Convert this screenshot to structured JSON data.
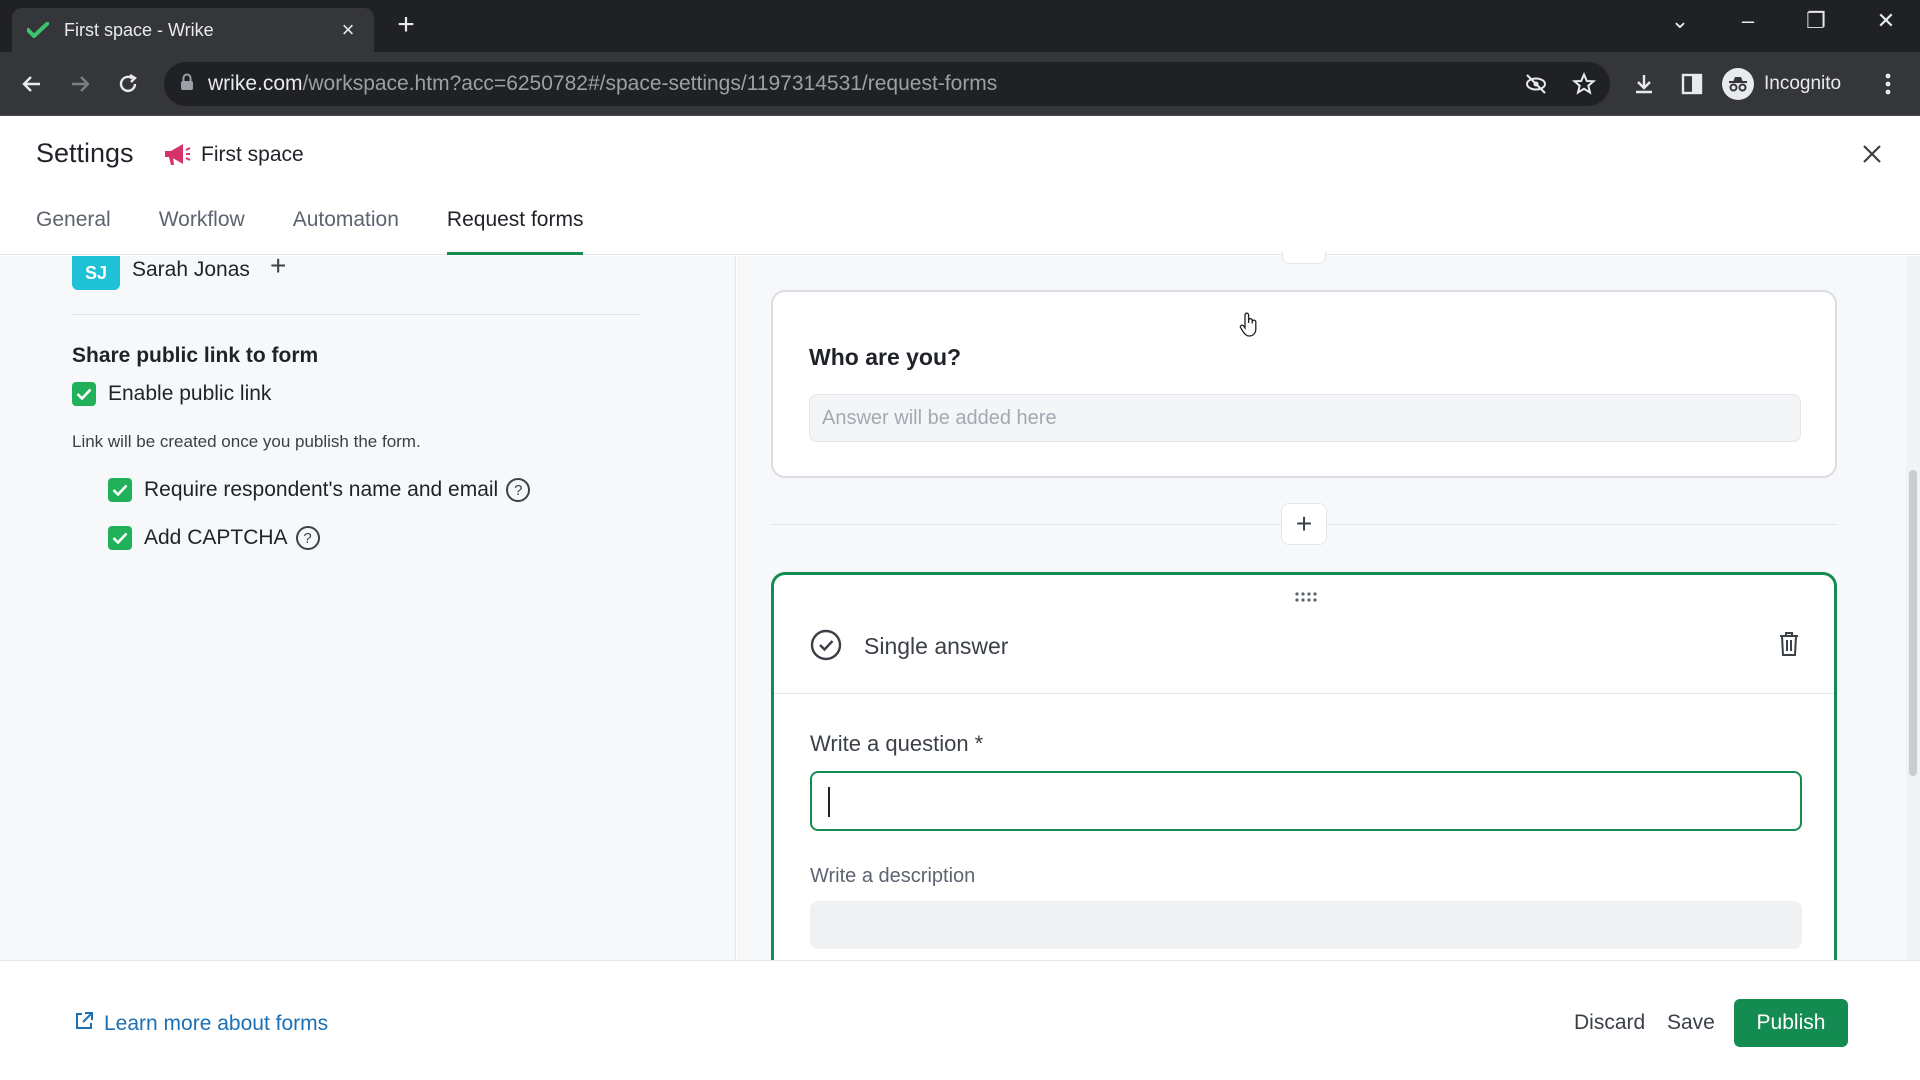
{
  "browser": {
    "tab_title": "First space - Wrike",
    "url_host": "wrike.com",
    "url_path": "/workspace.htm?acc=6250782#/space-settings/1197314531/request-forms",
    "profile_label": "Incognito"
  },
  "header": {
    "title": "Settings",
    "space_name": "First space",
    "tabs": [
      "General",
      "Workflow",
      "Automation",
      "Request forms"
    ],
    "active_tab": "Request forms"
  },
  "left_panel": {
    "user_initials": "SJ",
    "user_name": "Sarah Jonas",
    "share_heading": "Share public link to form",
    "enable_public_link": "Enable public link",
    "enable_public_link_checked": true,
    "link_hint": "Link will be created once you publish the form.",
    "require_name_email": "Require respondent's name and email",
    "require_name_email_checked": true,
    "add_captcha": "Add CAPTCHA",
    "add_captcha_checked": true,
    "help_glyph": "?"
  },
  "form": {
    "question_card": {
      "question": "Who are you?",
      "answer_placeholder": "Answer will be added here"
    },
    "add_button_glyph": "+",
    "edit_card": {
      "type_label": "Single answer",
      "question_label": "Write a question *",
      "question_value": "",
      "description_label": "Write a description",
      "description_value": ""
    }
  },
  "footer": {
    "learn_more": "Learn more about forms",
    "discard": "Discard",
    "save": "Save",
    "publish": "Publish"
  },
  "colors": {
    "accent_green": "#148c51",
    "checkbox_green": "#20b15a",
    "avatar_cyan": "#1ec1d6",
    "link_blue": "#1a6fb5",
    "space_icon_pink": "#d6336c"
  },
  "icons": [
    "wrike-check-icon",
    "close-icon",
    "new-tab-icon",
    "back-icon",
    "forward-icon",
    "reload-icon",
    "lock-icon",
    "eye-off-icon",
    "star-icon",
    "download-icon",
    "sidepanel-icon",
    "incognito-icon",
    "more-vert-icon",
    "megaphone-icon",
    "help-icon",
    "drag-handle-icon",
    "check-circle-icon",
    "trash-icon",
    "external-link-icon"
  ]
}
